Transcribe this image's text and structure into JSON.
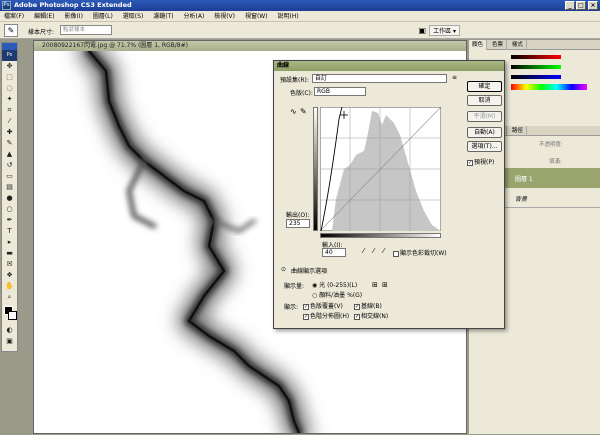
{
  "app": {
    "title": "Adobe Photoshop CS3 Extended",
    "logo": "Ps"
  },
  "menu": [
    "檔案(F)",
    "編輯(E)",
    "影像(I)",
    "圖層(L)",
    "選取(S)",
    "濾鏡(T)",
    "分析(A)",
    "檢視(V)",
    "視窗(W)",
    "說明(H)"
  ],
  "options": {
    "sample_label": "樣本尺寸:",
    "sample_value": "點狀樣本",
    "workspace": "工作區 ▾"
  },
  "document": {
    "title": "20080922167閃電.jpg @ 71.7% (圖層 1, RGB/8#)"
  },
  "panels": {
    "top_tabs": [
      "顏色",
      "色票",
      "樣式"
    ],
    "mid_tabs": [
      "圖層",
      "色版",
      "路徑"
    ],
    "opacity_label": "不透明度:",
    "fill_label": "填滿:",
    "layers": [
      "圖層 1",
      "背景"
    ]
  },
  "dialog": {
    "title": "曲線",
    "preset_label": "預設集(R):",
    "preset_value": "自訂",
    "channel_label": "色版(C):",
    "channel_value": "RGB",
    "output_label": "輸出(O):",
    "output_value": "235",
    "input_label": "輸入(I):",
    "input_value": "40",
    "show_clipping": "顯示色彩裁切(W)",
    "buttons": {
      "ok": "確定",
      "cancel": "取消",
      "smooth": "平滑(M)",
      "auto": "自動(A)",
      "options": "選項(T)..."
    },
    "preview": "預視(P)",
    "display_options": "曲線顯示選項",
    "show_amount": "顯示量:",
    "light": "光 (0-255)(L)",
    "pigment": "顏料/油墨 %(G)",
    "show": "顯示:",
    "channel_overlays": "色版覆蓋(V)",
    "baseline": "基線(B)",
    "histogram": "色階分佈圖(H)",
    "intersection": "相交線(N)"
  }
}
